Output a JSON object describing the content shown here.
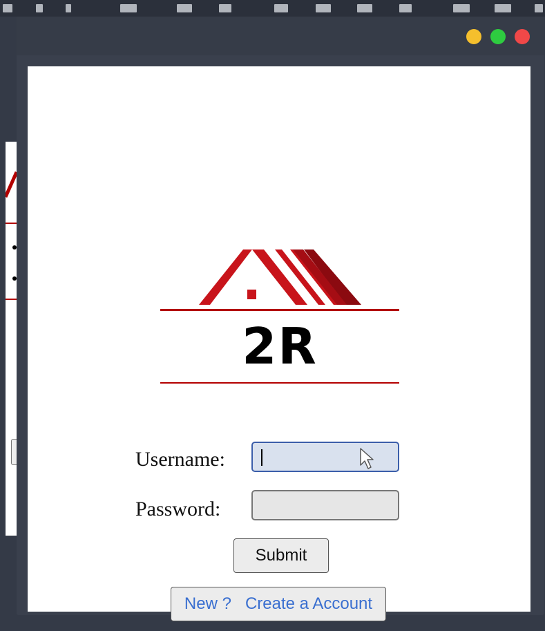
{
  "dialog": {
    "window_controls": [
      "minimize",
      "maximize",
      "close"
    ]
  },
  "logo": {
    "brand_text": "2R"
  },
  "form": {
    "username_label": "Username:",
    "username_value": "",
    "password_label": "Password:",
    "password_value": "",
    "submit_label": "Submit",
    "new_prompt": "New ?",
    "create_account_label": "Create a Account"
  },
  "colors": {
    "brand_red": "#b30000",
    "link_blue": "#3a6fd0",
    "focus_border": "#3b5eaa"
  }
}
